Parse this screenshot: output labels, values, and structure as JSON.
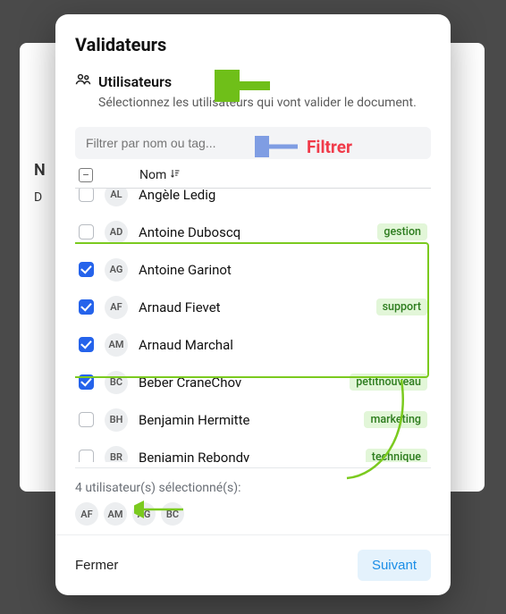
{
  "modal": {
    "title": "Validateurs",
    "section": {
      "heading": "Utilisateurs",
      "subheading": "Sélectionnez les utilisateurs qui vont valider le document."
    },
    "filter": {
      "placeholder": "Filtrer par nom ou tag..."
    },
    "table": {
      "name_header": "Nom"
    },
    "rows": [
      {
        "initials": "AL",
        "name": "Angèle Ledig",
        "checked": false,
        "tag": null
      },
      {
        "initials": "AD",
        "name": "Antoine Duboscq",
        "checked": false,
        "tag": "gestion"
      },
      {
        "initials": "AG",
        "name": "Antoine Garinot",
        "checked": true,
        "tag": null
      },
      {
        "initials": "AF",
        "name": "Arnaud Fievet",
        "checked": true,
        "tag": "support"
      },
      {
        "initials": "AM",
        "name": "Arnaud Marchal",
        "checked": true,
        "tag": null
      },
      {
        "initials": "BC",
        "name": "Beber CraneChov",
        "checked": true,
        "tag": "petitnouveau"
      },
      {
        "initials": "BH",
        "name": "Benjamin Hermitte",
        "checked": false,
        "tag": "marketing"
      },
      {
        "initials": "BR",
        "name": "Benjamin Rebondy",
        "checked": false,
        "tag": "technique"
      }
    ],
    "summary": {
      "text": "4 utilisateur(s) sélectionné(s):",
      "selected_initials": [
        "AF",
        "AM",
        "AG",
        "BC"
      ]
    },
    "footer": {
      "close": "Fermer",
      "next": "Suivant"
    }
  },
  "annotations": {
    "filter_label": "Filtrer"
  },
  "backdrop": {
    "partial_n": "N",
    "partial_d": "D"
  }
}
